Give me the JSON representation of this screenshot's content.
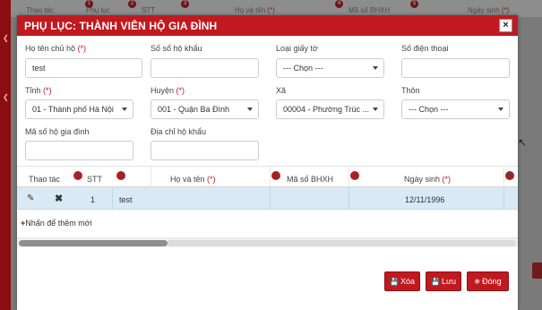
{
  "background": {
    "header": {
      "col1": "Thao tác",
      "col2": "Phụ lục",
      "col3": "STT",
      "col4": "Họ và tên",
      "col4_req": "(*)",
      "col5": "Mã số BHXH",
      "col6": "Ngày sinh",
      "col6_req": "(*)"
    }
  },
  "modal": {
    "title": "PHỤ LỤC: THÀNH VIÊN HỘ GIA ĐÌNH",
    "close_label": "×"
  },
  "form": {
    "ho_ten_chu_ho": {
      "label": "Họ tên chủ hộ",
      "req": "(*)",
      "value": "test"
    },
    "so_so_ho_khau": {
      "label": "Số sổ hộ khẩu",
      "value": ""
    },
    "loai_giay_to": {
      "label": "Loại giấy tờ",
      "value": "--- Chọn ---"
    },
    "so_dien_thoai": {
      "label": "Số điện thoại",
      "value": ""
    },
    "tinh": {
      "label": "Tỉnh",
      "req": "(*)",
      "value": "01 - Thành phố Hà Nội"
    },
    "huyen": {
      "label": "Huyện",
      "req": "(*)",
      "value": "001 - Quận Ba Đình"
    },
    "xa": {
      "label": "Xã",
      "value": "00004 - Phường Trúc ..."
    },
    "thon": {
      "label": "Thôn",
      "value": "--- Chọn ---"
    },
    "ma_so_ho_gia_dinh": {
      "label": "Mã số hộ gia đình",
      "value": ""
    },
    "dia_chi_ho_khau": {
      "label": "Địa chỉ hộ khẩu",
      "value": ""
    }
  },
  "grid": {
    "headers": {
      "thao_tac": "Thao tác",
      "stt": "STT",
      "ho_va_ten": "Họ và tên",
      "ho_va_ten_req": "(*)",
      "ma_so_bhxh": "Mã số BHXH",
      "ngay_sinh": "Ngày sinh",
      "ngay_sinh_req": "(*)"
    },
    "badges": [
      "1",
      "2",
      "3",
      "4",
      "5"
    ],
    "rows": [
      {
        "stt": "1",
        "ho_va_ten": "test",
        "ma_so_bhxh": "",
        "ngay_sinh": "12/11/1996"
      }
    ],
    "add_new": "Nhấn để thêm mới",
    "scroll_fraction": 0.3
  },
  "buttons": {
    "xoa": "Xóa",
    "luu": "Lưu",
    "dong": "Đóng"
  },
  "colors": {
    "primary": "#c0191f",
    "row_selected": "#d9e9f5"
  }
}
